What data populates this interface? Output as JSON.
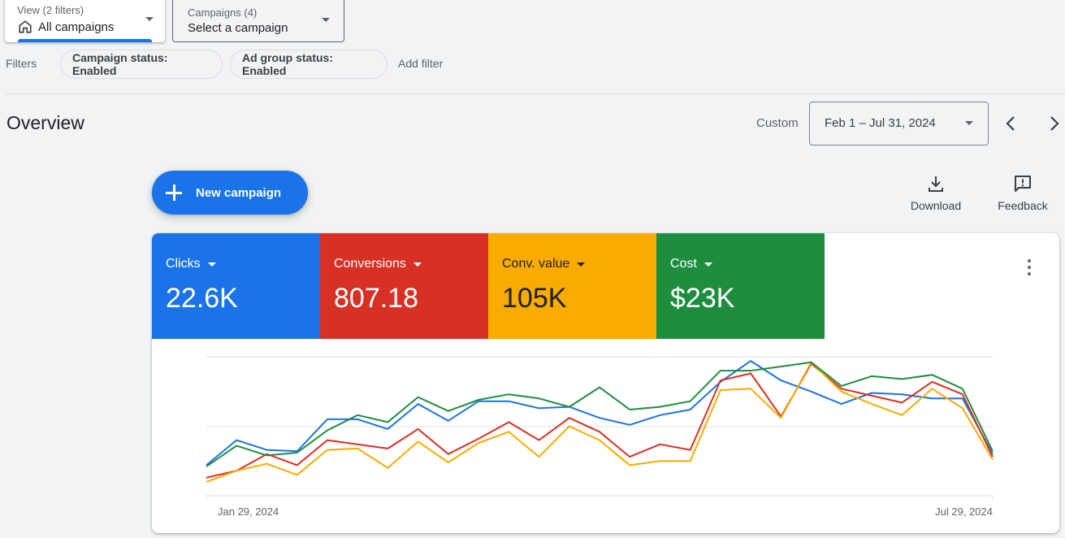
{
  "view_picker": {
    "subtitle": "View (2 filters)",
    "value": "All campaigns",
    "icon": "home-icon"
  },
  "campaign_picker": {
    "subtitle": "Campaigns (4)",
    "value": "Select a campaign"
  },
  "filters": {
    "label": "Filters",
    "chips": [
      "Campaign status: Enabled",
      "Ad group status: Enabled"
    ],
    "add_label": "Add filter"
  },
  "overview": {
    "title": "Overview",
    "range_type": "Custom",
    "date_range": "Feb 1 – Jul 31, 2024"
  },
  "actions": {
    "new_campaign": "New campaign",
    "download": "Download",
    "feedback": "Feedback"
  },
  "metrics": [
    {
      "label": "Clicks",
      "value": "22.6K",
      "color": "#1a73e8"
    },
    {
      "label": "Conversions",
      "value": "807.18",
      "color": "#d93025"
    },
    {
      "label": "Conv. value",
      "value": "105K",
      "color": "#f9ab00"
    },
    {
      "label": "Cost",
      "value": "$23K",
      "color": "#1e8e3e"
    }
  ],
  "chart_data": {
    "type": "line",
    "x_start_label": "Jan 29, 2024",
    "x_end_label": "Jul 29, 2024",
    "grid": true,
    "y_scale": "relative (0–100)",
    "ylim": [
      0,
      100
    ],
    "series": [
      {
        "color": "#1a73e8",
        "values": [
          22,
          40,
          33,
          32,
          55,
          55,
          48,
          66,
          54,
          68,
          68,
          63,
          64,
          56,
          51,
          58,
          62,
          82,
          97,
          83,
          75,
          66,
          74,
          73,
          70,
          70,
          30
        ]
      },
      {
        "color": "#d93025",
        "values": [
          13,
          18,
          30,
          22,
          40,
          37,
          34,
          48,
          30,
          41,
          53,
          40,
          56,
          46,
          28,
          37,
          33,
          83,
          88,
          57,
          95,
          77,
          72,
          67,
          82,
          73,
          28
        ]
      },
      {
        "color": "#f9ab00",
        "values": [
          10,
          18,
          23,
          15,
          33,
          34,
          20,
          39,
          24,
          38,
          46,
          28,
          50,
          40,
          22,
          25,
          25,
          76,
          77,
          56,
          96,
          75,
          66,
          58,
          77,
          63,
          26
        ]
      },
      {
        "color": "#1e8e3e",
        "values": [
          21,
          36,
          29,
          31,
          47,
          58,
          53,
          71,
          61,
          69,
          73,
          70,
          64,
          78,
          62,
          64,
          68,
          90,
          90,
          93,
          96,
          79,
          86,
          84,
          87,
          77,
          32
        ]
      }
    ]
  }
}
